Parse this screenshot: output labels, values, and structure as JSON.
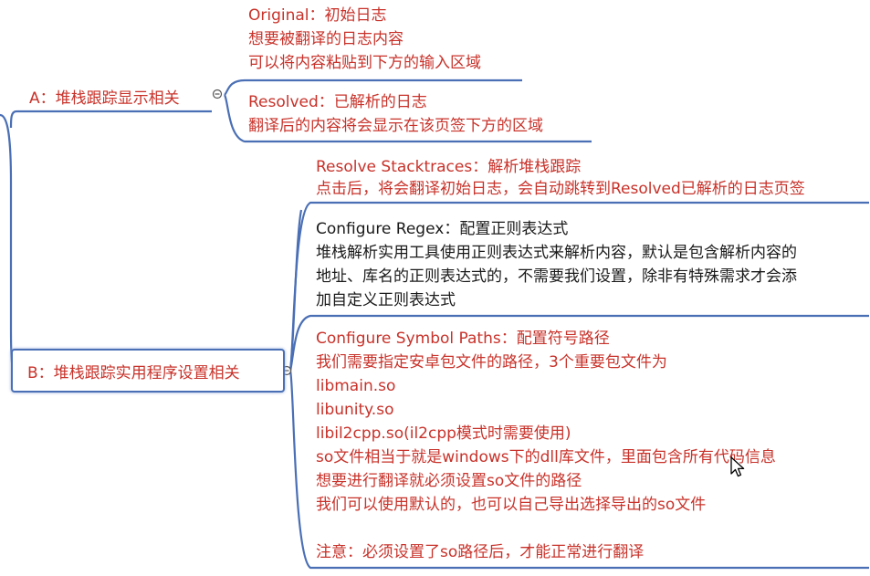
{
  "branch_a": {
    "label": "A：堆栈跟踪显示相关",
    "original": [
      "Original：初始日志",
      "想要被翻译的日志内容",
      "可以将内容粘贴到下方的输入区域"
    ],
    "resolved": [
      "Resolved：已解析的日志",
      "翻译后的内容将会显示在该页签下方的区域"
    ]
  },
  "branch_b": {
    "label": "B：堆栈跟踪实用程序设置相关",
    "resolve_stacktraces": [
      "Resolve Stacktraces：解析堆栈跟踪",
      "点击后，将会翻译初始日志，会自动跳转到Resolved已解析的日志页签"
    ],
    "configure_regex": [
      "Configure Regex：配置正则表达式",
      "堆栈解析实用工具使用正则表达式来解析内容，默认是包含解析内容的",
      "地址、库名的正则表达式的，不需要我们设置，除非有特殊需求才会添",
      "加自定义正则表达式"
    ],
    "configure_symbol_paths": [
      "Configure Symbol Paths：配置符号路径",
      "我们需要指定安卓包文件的路径，3个重要包文件为",
      "libmain.so",
      "libunity.so",
      "libil2cpp.so(il2cpp模式时需要使用)",
      "so文件相当于就是windows下的dll库文件，里面包含所有代码信息",
      "想要进行翻译就必须设置so文件的路径",
      "我们可以使用默认的，也可以自己导出选择导出的so文件",
      "",
      "注意：必须设置了so路径后，才能正常进行翻译"
    ]
  },
  "colors": {
    "red_text": "#c8322a",
    "connector": "#4a6fb5",
    "black_text": "#1a1a1a"
  }
}
